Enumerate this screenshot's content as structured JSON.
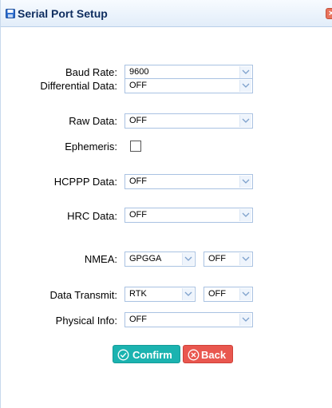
{
  "dialog": {
    "title": "Serial Port Setup",
    "close_label": "×"
  },
  "form": {
    "baud_rate": {
      "label": "Baud Rate:",
      "value": "9600"
    },
    "differential_data": {
      "label": "Differential Data:",
      "value": "OFF"
    },
    "raw_data": {
      "label": "Raw Data:",
      "value": "OFF"
    },
    "ephemeris": {
      "label": "Ephemeris:",
      "checked": false
    },
    "hcppp_data": {
      "label": "HCPPP Data:",
      "value": "OFF"
    },
    "hrc_data": {
      "label": "HRC Data:",
      "value": "OFF"
    },
    "nmea": {
      "label": "NMEA:",
      "type_value": "GPGGA",
      "rate_value": "OFF"
    },
    "data_transmit": {
      "label": "Data Transmit:",
      "type_value": "RTK",
      "rate_value": "OFF"
    },
    "physical_info": {
      "label": "Physical Info:",
      "value": "OFF"
    }
  },
  "buttons": {
    "confirm_label": "Confirm",
    "back_label": "Back"
  },
  "colors": {
    "confirm": "#1bb3b0",
    "back": "#e9574f",
    "title_text": "#0e2d5f",
    "field_border": "#a9c2e2"
  }
}
